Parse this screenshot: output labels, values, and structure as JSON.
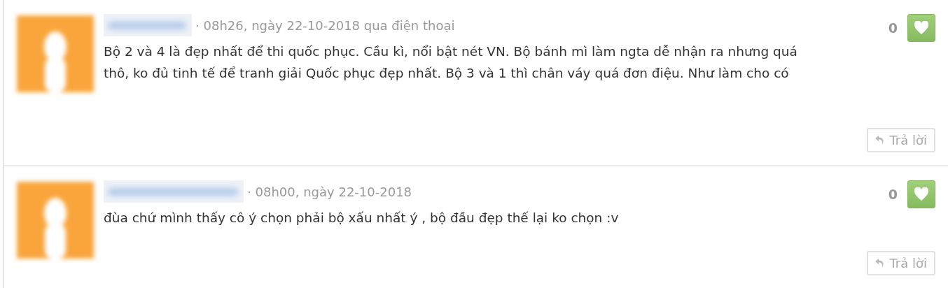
{
  "comments": [
    {
      "meta": "· 08h26, ngày 22-10-2018 qua điện thoại",
      "text": "Bộ 2 và 4 là đẹp nhất để thi quốc phục. Cầu kì, nổi bật nét VN. Bộ bánh mì làm ngta dễ nhận ra nhưng quá thô, ko đủ tinh tế để tranh giải Quốc phục đẹp nhất. Bộ 3 và 1 thì chân váy quá đơn điệu. Như làm cho có",
      "likes": "0",
      "reply": "Trả lời"
    },
    {
      "meta": "· 08h00, ngày 22-10-2018",
      "text": "đùa chứ mình thấy cô ý chọn phải bộ xấu nhất ý , bộ đầu đẹp thế lại ko chọn :v",
      "likes": "0",
      "reply": "Trả lời"
    }
  ]
}
